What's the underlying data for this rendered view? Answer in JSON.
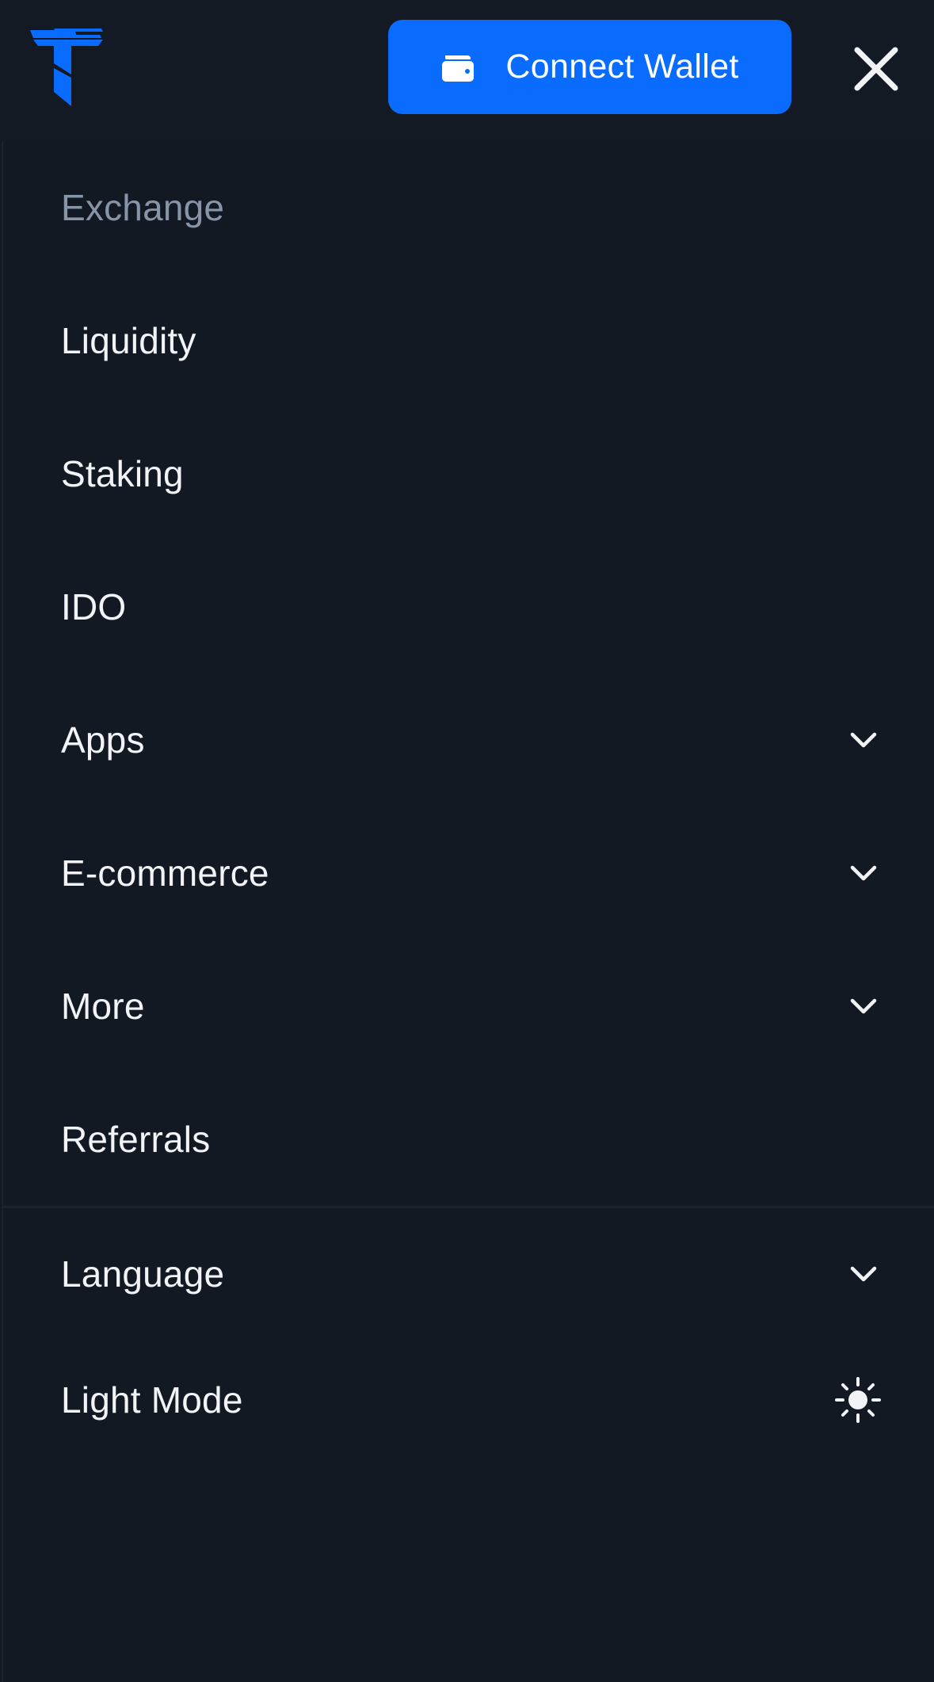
{
  "header": {
    "logo_icon": "triple-t-logo-icon",
    "connect_wallet_label": "Connect Wallet",
    "wallet_icon": "wallet-icon",
    "close_icon": "close-icon"
  },
  "menu": {
    "items": [
      {
        "label": "Exchange",
        "active": true
      },
      {
        "label": "Liquidity"
      },
      {
        "label": "Staking"
      },
      {
        "label": "IDO"
      },
      {
        "label": "Apps",
        "icon": "chevron-down-icon"
      },
      {
        "label": "E-commerce",
        "icon": "chevron-down-icon"
      },
      {
        "label": "More",
        "icon": "chevron-down-icon"
      },
      {
        "label": "Referrals"
      }
    ],
    "settings": [
      {
        "label": "Language",
        "icon": "chevron-down-icon"
      },
      {
        "label": "Light Mode",
        "icon": "sun-icon"
      }
    ]
  },
  "colors": {
    "background": "#131922",
    "accent": "#0a6cff",
    "text": "#f1f3f6",
    "muted_text": "#8795a8"
  }
}
